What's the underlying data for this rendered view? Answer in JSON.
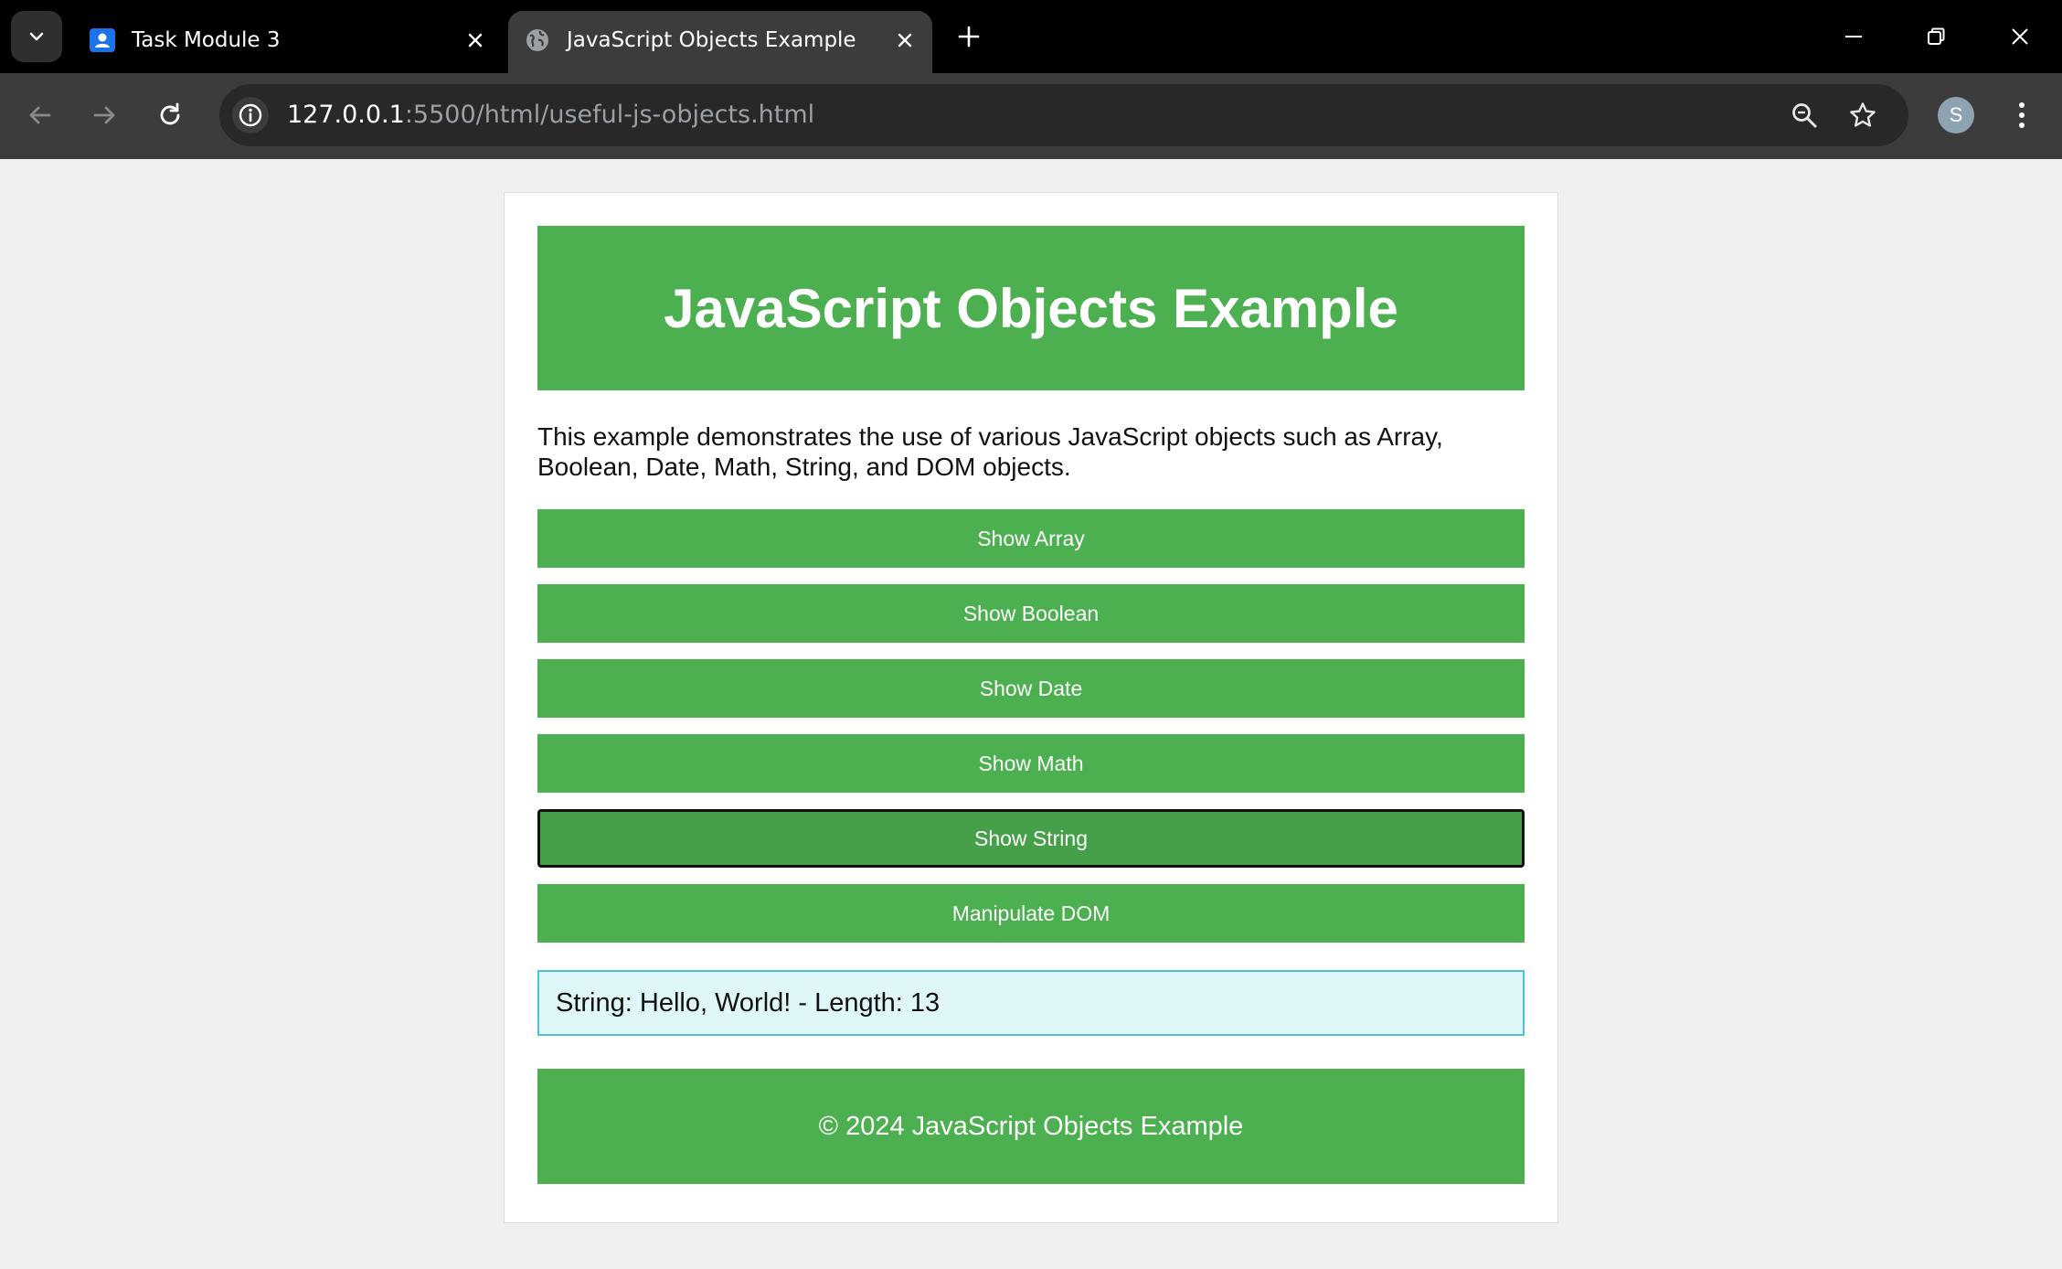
{
  "browser": {
    "tabs": [
      {
        "title": "Task Module 3",
        "favicon": "contacts-icon",
        "active": false
      },
      {
        "title": "JavaScript Objects Example",
        "favicon": "globe-icon",
        "active": true
      }
    ],
    "url_host": "127.0.0.1",
    "url_path": ":5500/html/useful-js-objects.html",
    "profile_initial": "S"
  },
  "page": {
    "heading": "JavaScript Objects Example",
    "intro": "This example demonstrates the use of various JavaScript objects such as Array, Boolean, Date, Math, String, and DOM objects.",
    "buttons": [
      {
        "label": "Show Array"
      },
      {
        "label": "Show Boolean"
      },
      {
        "label": "Show Date"
      },
      {
        "label": "Show Math"
      },
      {
        "label": "Show String",
        "focused": true
      },
      {
        "label": "Manipulate DOM"
      }
    ],
    "output": "String: Hello, World! - Length: 13",
    "footer": "© 2024 JavaScript Objects Example"
  },
  "colors": {
    "accent": "#4caf50",
    "accent_hover": "#45a049",
    "output_bg": "#e0f7fa",
    "output_border": "#4dc3d8"
  }
}
